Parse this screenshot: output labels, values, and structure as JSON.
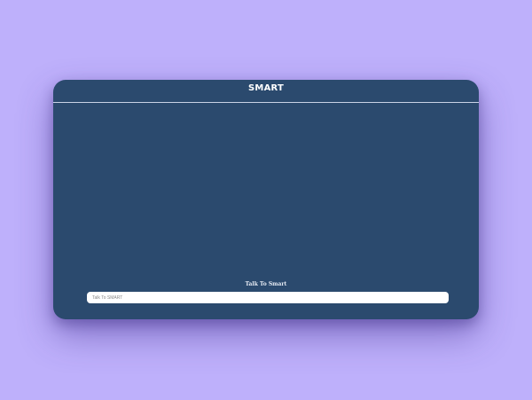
{
  "app": {
    "title": "SMART"
  },
  "composer": {
    "label": "Talk To Smart",
    "placeholder": "Talk To SMART",
    "value": ""
  },
  "messages": [],
  "colors": {
    "page_background": "#beb0fb",
    "window_background": "#2b4a6e",
    "header_divider": "#c9d3e6",
    "input_background": "#ffffff",
    "title_text": "#ffffff"
  }
}
